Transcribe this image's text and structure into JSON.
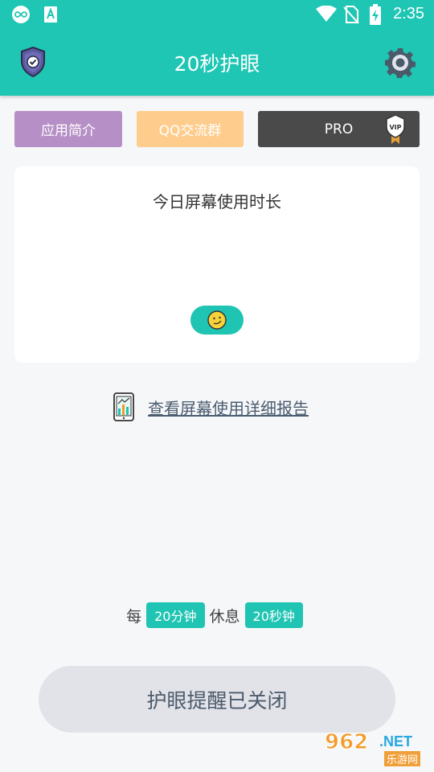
{
  "status_bar": {
    "time": "2:35",
    "icons": [
      "infinity-app-icon",
      "text-app-icon",
      "wifi-icon",
      "no-sim-icon",
      "battery-charging-icon"
    ]
  },
  "app_bar": {
    "title": "20秒护眼",
    "left_icon": "shield-check-icon",
    "right_icon": "gear-icon"
  },
  "top_buttons": {
    "intro": "应用简介",
    "qq": "QQ交流群",
    "pro": "PRO",
    "pro_badge": "VIP"
  },
  "card": {
    "title": "今日屏幕使用时长",
    "indicator_icon": "smiley-icon"
  },
  "report_link": {
    "label": "查看屏幕使用详细报告",
    "icon": "phone-chart-icon"
  },
  "interval": {
    "prefix": "每",
    "work_duration": "20分钟",
    "middle": "休息",
    "rest_duration": "20秒钟"
  },
  "main_button": {
    "label": "护眼提醒已关闭"
  },
  "watermark": {
    "logo_number": "962",
    "logo_suffix": ".NET",
    "logo_cn": "乐游网"
  },
  "colors": {
    "primary": "#1fc6b4",
    "intro_button": "#b58fc5",
    "qq_button": "#fecd8d",
    "pro_button": "#4a4a4a",
    "main_button_bg": "#e1e3e8"
  }
}
